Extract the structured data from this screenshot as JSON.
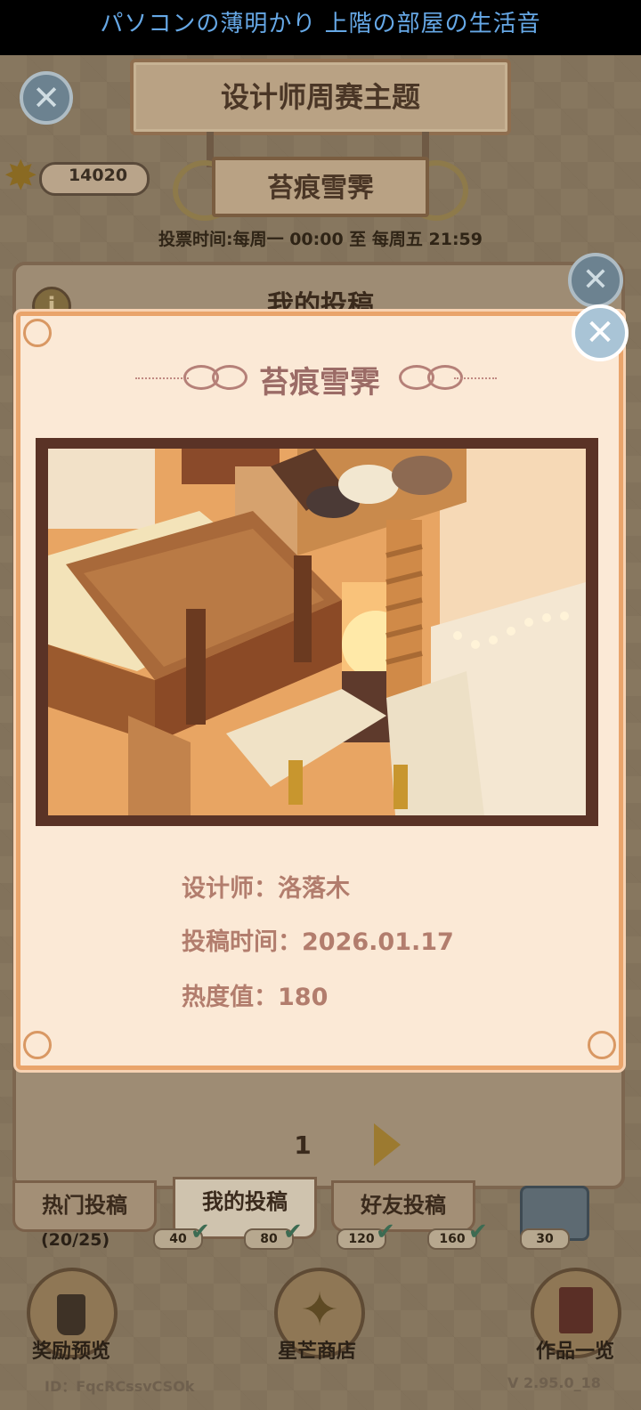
{
  "top_banner": {
    "text": "パソコンの薄明かり 上階の部屋の生活音"
  },
  "header": {
    "theme_title": "设计师周赛主题",
    "theme_name": "苔痕雪霁",
    "vote_time": "投票时间:每周一 00:00 至 每周五 21:59",
    "star_currency": "14020",
    "close_icon": "close-icon"
  },
  "background_panel": {
    "title": "我的投稿",
    "info_icon": "i",
    "page": "1",
    "tabs": [
      {
        "label": "热门投稿"
      },
      {
        "label": "我的投稿"
      },
      {
        "label": "好友投稿"
      }
    ],
    "progress": "(20/25)",
    "milestones": [
      "40",
      "80",
      "120",
      "160",
      "30"
    ]
  },
  "bottom_nav": {
    "reward_preview": "奖励预览",
    "star_shop": "星芒商店",
    "works_list": "作品一览",
    "user_id": "ID：FqcRCssvCSOk",
    "version": "V 2.95.0_18"
  },
  "modal": {
    "title": "苔痕雪霁",
    "designer": "设计师：洛落木",
    "submit_time": "投稿时间：2026.01.17",
    "heat": "热度值：180"
  },
  "colors": {
    "modal_bg": "#fbe9d6",
    "modal_border": "#e9a46b",
    "modal_text": "#b27d6d",
    "title_text": "#9b6b66",
    "close_button": "#6c8290"
  }
}
